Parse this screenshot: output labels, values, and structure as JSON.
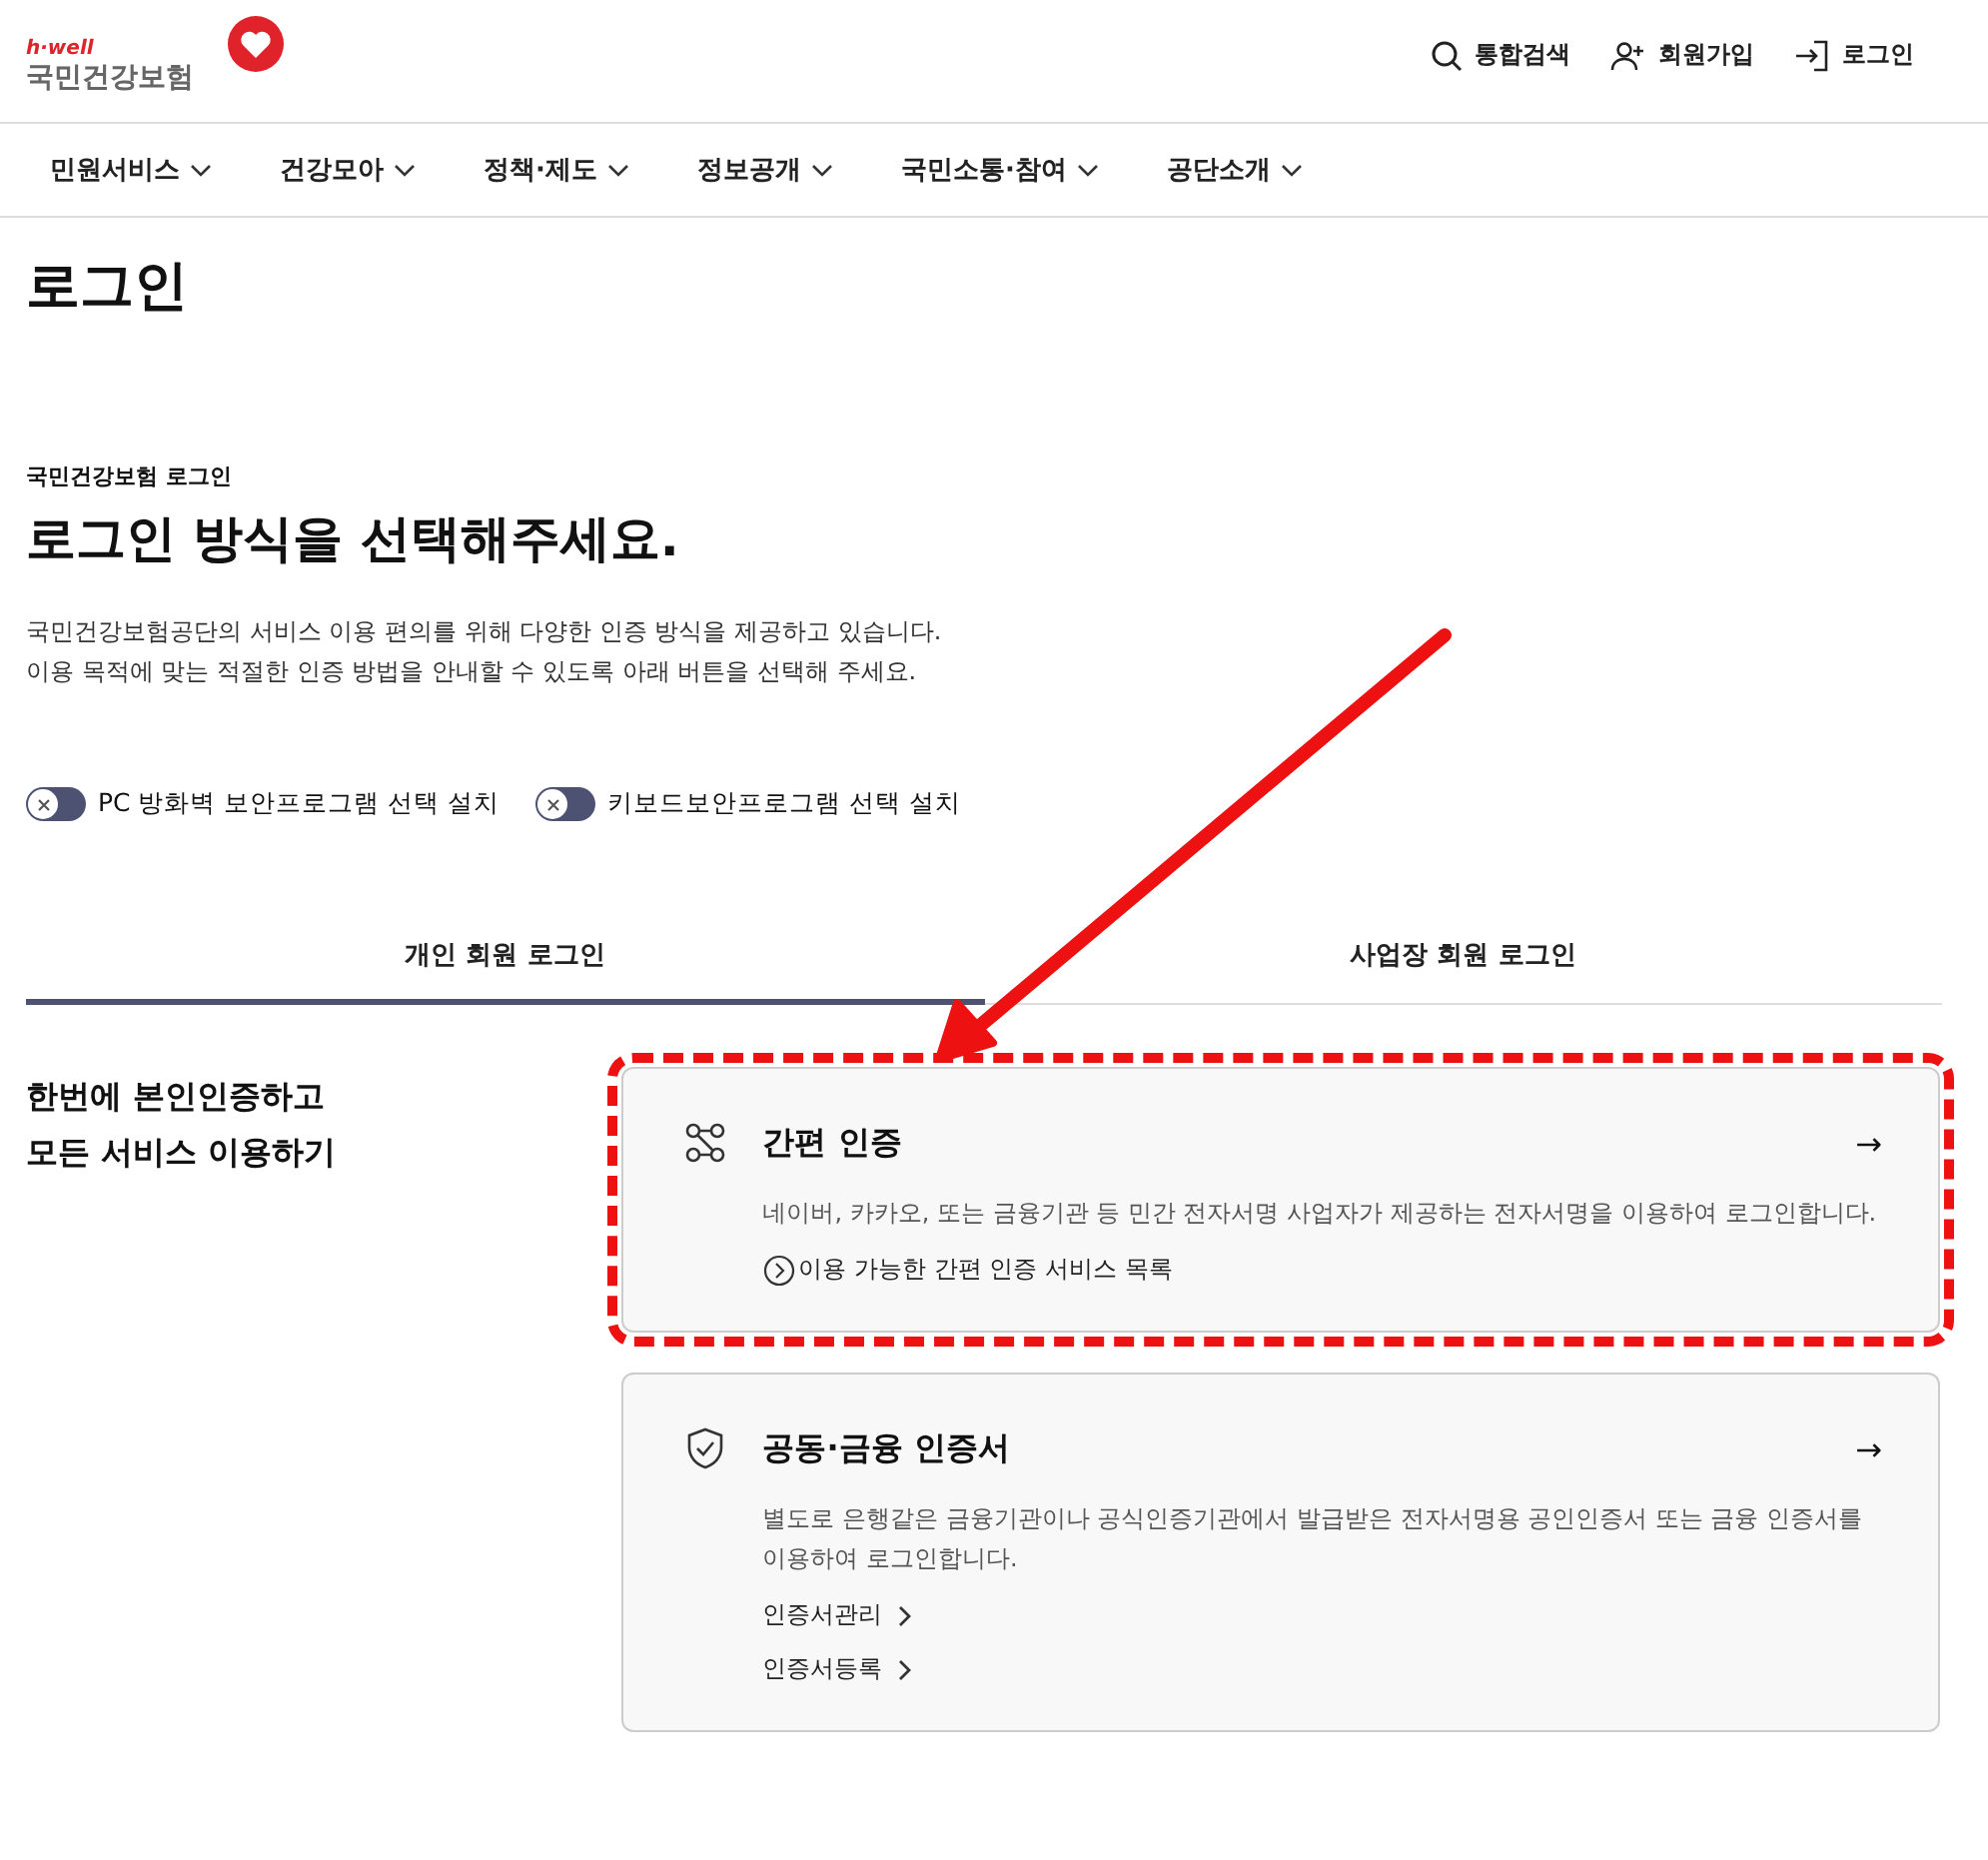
{
  "logo": {
    "tagline": "h·well",
    "name": "국민건강보험"
  },
  "utility_links": [
    {
      "label": "통합검색"
    },
    {
      "label": "회원가입"
    },
    {
      "label": "로그인"
    }
  ],
  "nav": [
    {
      "label": "민원서비스"
    },
    {
      "label": "건강모아"
    },
    {
      "label": "정책·제도"
    },
    {
      "label": "정보공개"
    },
    {
      "label": "국민소통·참여"
    },
    {
      "label": "공단소개"
    }
  ],
  "page_title": "로그인",
  "subtitle": "국민건강보험 로그인",
  "heading": "로그인 방식을 선택해주세요.",
  "intro": [
    "국민건강보험공단의 서비스 이용 편의를 위해 다양한 인증 방식을 제공하고 있습니다.",
    "이용 목적에 맞는 적절한 인증 방법을 안내할 수 있도록 아래 버튼을 선택해 주세요."
  ],
  "toggles": [
    {
      "label": "PC 방화벽 보안프로그램 선택 설치",
      "on": false
    },
    {
      "label": "키보드보안프로그램 선택 설치",
      "on": false
    }
  ],
  "tabs": [
    {
      "label": "개인 회원 로그인",
      "selected": true
    },
    {
      "label": "사업장 회원 로그인",
      "selected": false
    }
  ],
  "side_heading": [
    "한번에 본인인증하고",
    "모든 서비스 이용하기"
  ],
  "cards": [
    {
      "title": "간편 인증",
      "arrow": "→",
      "description": "네이버, 카카오, 또는 금융기관 등 민간 전자서명 사업자가 제공하는 전자서명을 이용하여 로그인합니다.",
      "links": [
        {
          "kind": "circle",
          "label": "이용 가능한 간편 인증 서비스 목록"
        }
      ],
      "highlighted": true
    },
    {
      "title": "공동·금융 인증서",
      "arrow": "→",
      "description": "별도로 은행같은 금융기관이나 공식인증기관에서 발급받은 전자서명용 공인인증서 또는 금융 인증서를 이용하여 로그인합니다.",
      "links": [
        {
          "kind": "chevron",
          "label": "인증서관리"
        },
        {
          "kind": "chevron",
          "label": "인증서등록"
        }
      ],
      "highlighted": false
    }
  ],
  "annotation": {
    "kind": "arrow"
  }
}
